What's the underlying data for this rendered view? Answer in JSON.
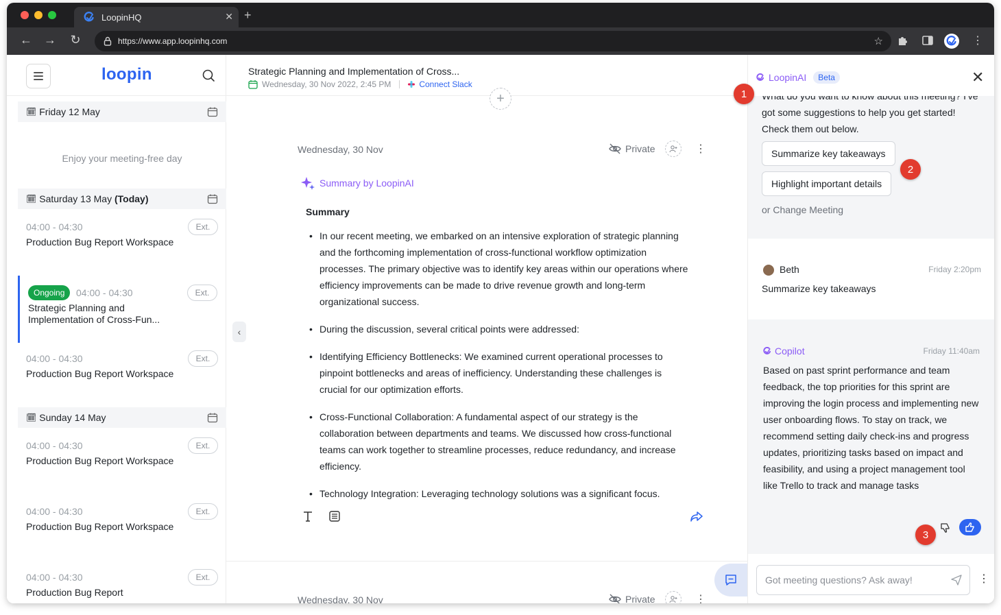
{
  "browser": {
    "tab_title": "LoopinHQ",
    "url": "https://www.app.loopinhq.com",
    "colors": {
      "red": "#ff5f57",
      "yellow": "#febc2e",
      "green": "#28c840"
    }
  },
  "sidebar": {
    "logo": "loopin",
    "days": [
      {
        "label": "Friday 12 May",
        "today": "",
        "empty_text": "Enjoy your meeting-free day"
      },
      {
        "label": "Saturday 13 May",
        "today": "(Today)"
      },
      {
        "label": "Sunday 14 May",
        "today": ""
      }
    ],
    "meetings": [
      {
        "time": "04:00 - 04:30",
        "title": "Production Bug Report Workspace",
        "ext": "Ext."
      },
      {
        "time": "04:00 - 04:30",
        "title": "Strategic Planning and Implementation of Cross-Fun...",
        "ext": "Ext.",
        "status": "Ongoing"
      },
      {
        "time": "04:00 - 04:30",
        "title": "Production Bug Report Workspace",
        "ext": "Ext."
      },
      {
        "time": "04:00 - 04:30",
        "title": "Production Bug Report Workspace",
        "ext": "Ext."
      },
      {
        "time": "04:00 - 04:30",
        "title": "Production Bug Report Workspace",
        "ext": "Ext."
      },
      {
        "time": "04:00 - 04:30",
        "title": "Production Bug Report",
        "ext": "Ext."
      }
    ]
  },
  "main": {
    "title": "Strategic Planning and Implementation of Cross...",
    "datetime": "Wednesday, 30 Nov 2022, 2:45 PM",
    "connect_slack": "Connect Slack",
    "card": {
      "date": "Wednesday, 30 Nov",
      "private": "Private",
      "summary_by": "Summary by LoopinAI",
      "summary_heading": "Summary",
      "bullets": [
        "In our recent meeting, we embarked on an intensive exploration of strategic planning and the forthcoming implementation of cross-functional workflow optimization processes. The primary objective was to identify key areas within our operations where efficiency improvements can be made to drive revenue growth and long-term organizational success.",
        "During the discussion, several critical points were addressed:",
        "Identifying Efficiency Bottlenecks: We examined current operational processes to pinpoint bottlenecks and areas of inefficiency. Understanding these challenges is crucial for our optimization efforts.",
        " Cross-Functional Collaboration: A fundamental aspect of our strategy is the collaboration between departments and teams. We discussed how cross-functional teams can work together to streamline processes, reduce redundancy, and increase efficiency.",
        "Technology Integration: Leveraging technology solutions was a significant focus."
      ]
    },
    "card2": {
      "date": "Wednesday, 30 Nov",
      "private": "Private"
    }
  },
  "assistant": {
    "brand": "LoopinAI",
    "beta": "Beta",
    "intro": "What do you want to know about this meeting? I've got some suggestions to help you get started! Check them out below.",
    "suggestions": [
      "Summarize key takeaways",
      "Highlight important details"
    ],
    "change_meeting": "or Change Meeting",
    "user_message": {
      "name": "Beth",
      "time": "Friday 2:20pm",
      "text": "Summarize key takeaways"
    },
    "copilot_message": {
      "name": "Copilot",
      "time": "Friday 11:40am",
      "text": "Based on past sprint performance and team feedback, the top priorities for this sprint are improving the login process and implementing new user onboarding flows. To stay on track, we recommend setting daily check-ins and progress updates, prioritizing tasks based on impact and feasibility, and using a project management tool like Trello to track and manage tasks"
    },
    "input_placeholder": "Got meeting questions? Ask away!"
  },
  "markers": [
    "1",
    "2",
    "3"
  ]
}
